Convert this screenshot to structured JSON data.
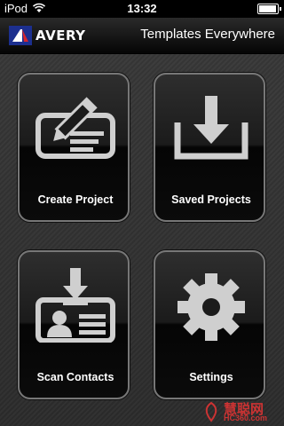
{
  "status_bar": {
    "carrier": "iPod",
    "time": "13:32"
  },
  "header": {
    "brand": "AVERY",
    "title": "Templates Everywhere"
  },
  "tiles": [
    {
      "label": "Create Project",
      "icon": "pencil-on-card-icon"
    },
    {
      "label": "Saved Projects",
      "icon": "download-tray-icon"
    },
    {
      "label": "Scan Contacts",
      "icon": "contact-card-scan-icon"
    },
    {
      "label": "Settings",
      "icon": "gear-icon"
    }
  ],
  "watermark": {
    "big": "慧聪网",
    "small": "HC360.com"
  },
  "colors": {
    "header": "#0b0b0b",
    "tile_border": "#777777",
    "icon": "#cfcfcf"
  }
}
